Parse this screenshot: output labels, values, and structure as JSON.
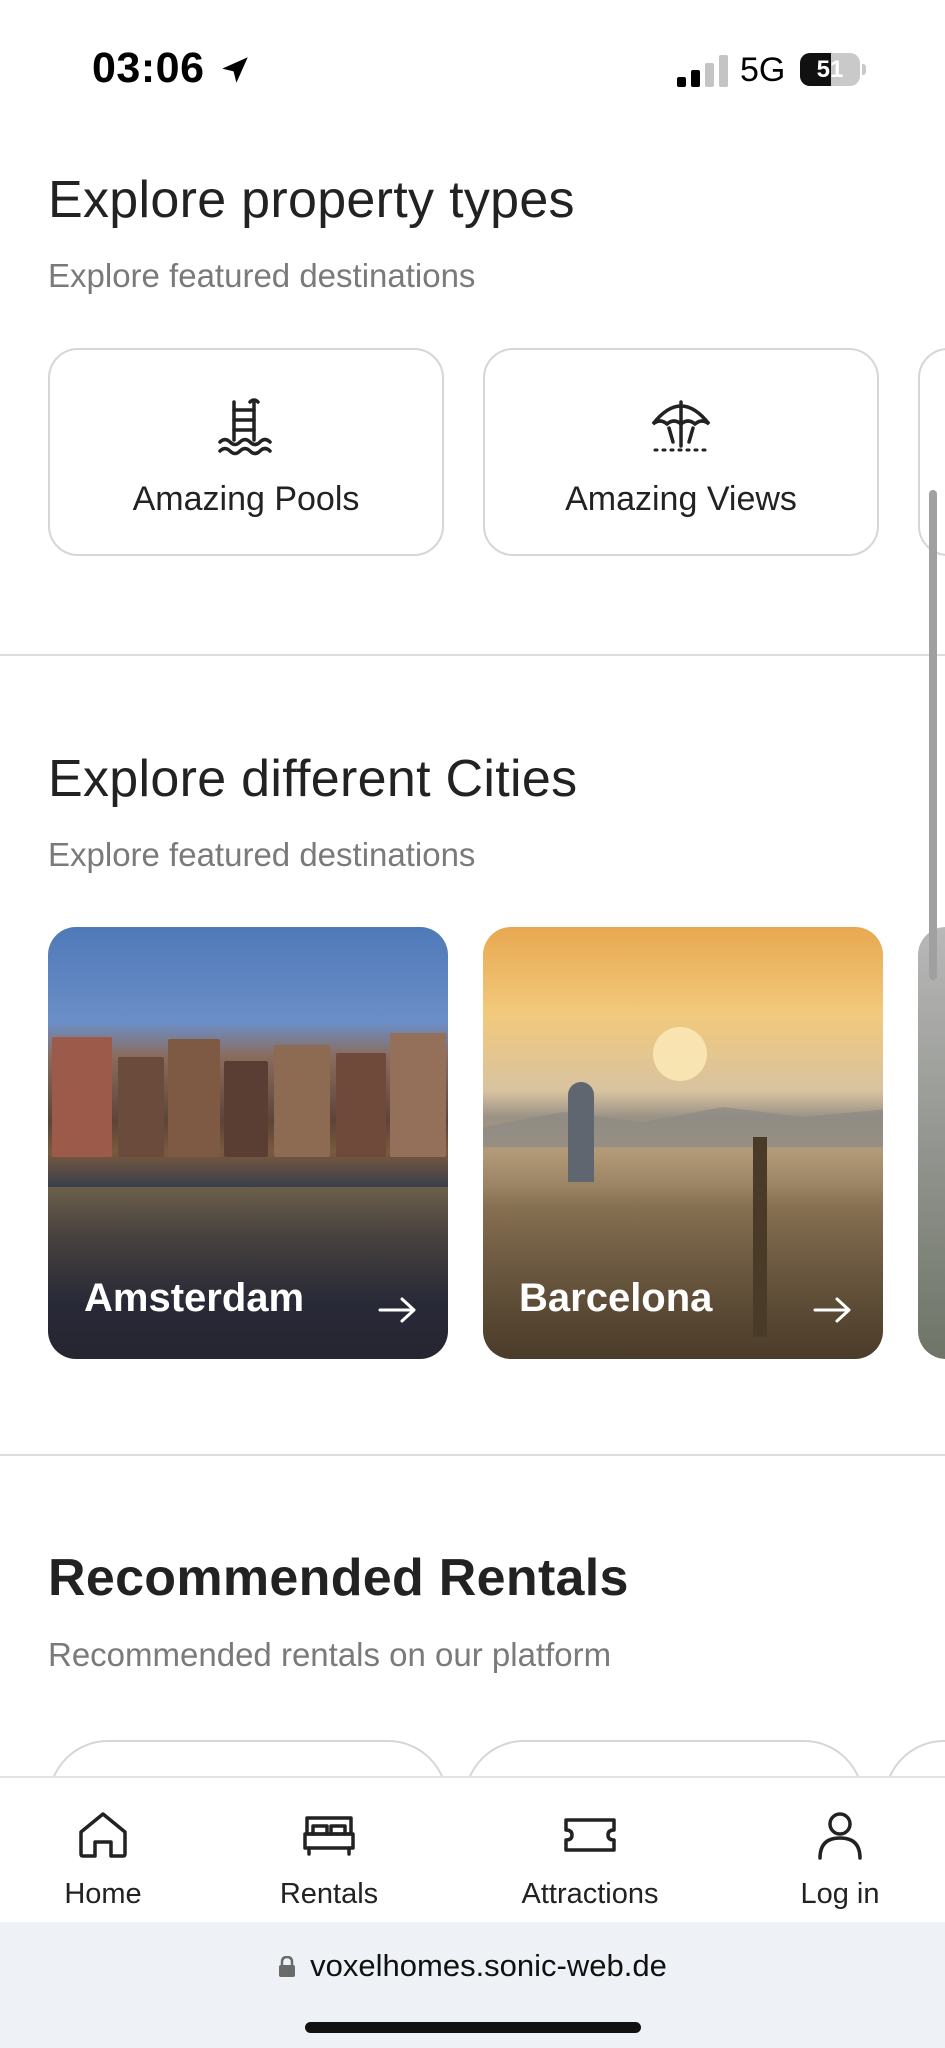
{
  "status_bar": {
    "time": "03:06",
    "network": "5G",
    "battery_level": "51",
    "battery_fraction": 0.51,
    "icons": [
      "location-arrow-icon",
      "signal-bars-icon",
      "battery-icon"
    ]
  },
  "property_types": {
    "title": "Explore property types",
    "subtitle": "Explore featured destinations",
    "items": [
      {
        "label": "Amazing Pools",
        "icon": "pool-icon"
      },
      {
        "label": "Amazing Views",
        "icon": "umbrella-icon"
      }
    ]
  },
  "cities": {
    "title": "Explore different Cities",
    "subtitle": "Explore featured destinations",
    "items": [
      {
        "name": "Amsterdam",
        "icon": "arrow-right-icon"
      },
      {
        "name": "Barcelona",
        "icon": "arrow-right-icon"
      }
    ]
  },
  "rentals": {
    "title": "Recommended Rentals",
    "subtitle": "Recommended rentals on our platform"
  },
  "bottom_nav": {
    "items": [
      {
        "label": "Home",
        "icon": "home-icon"
      },
      {
        "label": "Rentals",
        "icon": "bed-icon"
      },
      {
        "label": "Attractions",
        "icon": "ticket-icon"
      },
      {
        "label": "Log in",
        "icon": "user-icon"
      }
    ]
  },
  "browser": {
    "url": "voxelhomes.sonic-web.de"
  },
  "colors": {
    "text_primary": "#222222",
    "text_secondary": "#7a7a7a",
    "border": "#d6d6d6",
    "url_bar_bg": "#eef1f5"
  }
}
